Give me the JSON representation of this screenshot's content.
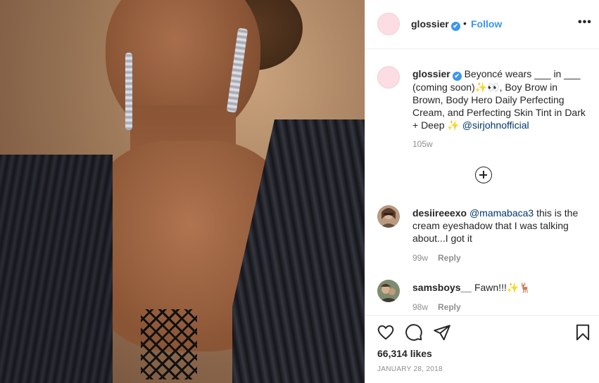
{
  "post": {
    "username": "glossier",
    "verified_mark": "✔",
    "separator": "•",
    "follow_label": "Follow",
    "more_label": "•••"
  },
  "caption": {
    "username": "glossier",
    "text_before_mention": "Beyoncé wears ___ in ___ (coming soon)✨👀, Boy Brow in Brown, Body Hero Daily Perfecting Cream, and Perfecting Skin Tint in Dark + Deep ✨ ",
    "mention": "@sirjohnofficial",
    "time": "105w"
  },
  "comments": [
    {
      "username": "desiireeexo",
      "mention": "@mamabaca3",
      "text": " this is the cream eyeshadow that I was talking about...I got it",
      "time": "99w",
      "reply_label": "Reply"
    },
    {
      "username": "samsboys__",
      "mention": "",
      "text": " Fawn!!!✨🦌",
      "time": "98w",
      "reply_label": "Reply"
    }
  ],
  "footer": {
    "likes": "66,314 likes",
    "date": "JANUARY 28, 2018"
  },
  "icons": {
    "like": "heart-icon",
    "comment": "comment-icon",
    "share": "paper-plane-icon",
    "save": "bookmark-icon",
    "load_more": "plus-circle-icon"
  },
  "colors": {
    "link_blue": "#3897f0",
    "mention_blue": "#00376b",
    "muted_gray": "#8e8e8e",
    "avatar_pink": "#fbdde3"
  }
}
